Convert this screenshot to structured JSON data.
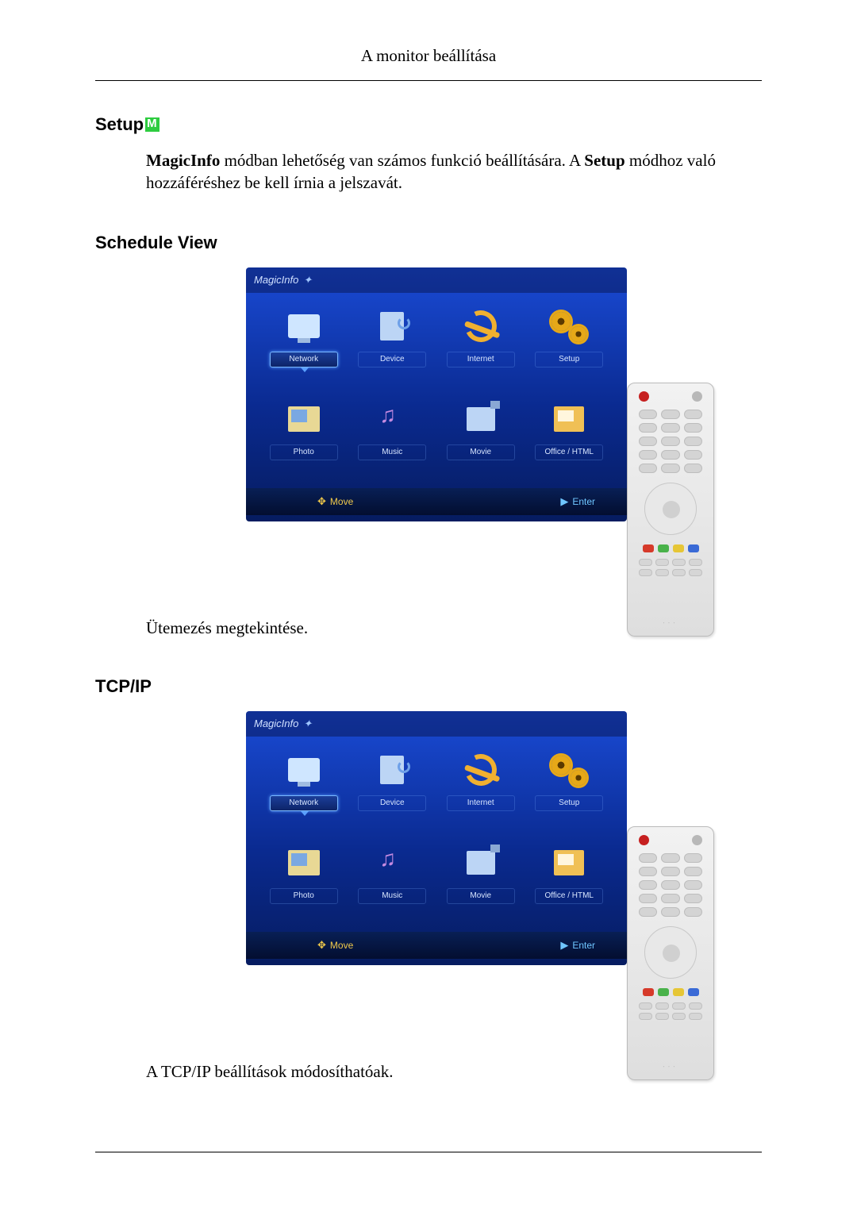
{
  "page_header": "A monitor beállítása",
  "sections": {
    "setup_heading": "Setup",
    "setup_body_bold1": "MagicInfo",
    "setup_body_mid": " módban lehetőség van számos funkció beállítására. A ",
    "setup_body_bold2": "Setup",
    "setup_body_end": " módhoz való hozzáféréshez be kell írnia a jelszavát.",
    "schedule_heading": "Schedule View",
    "schedule_caption": "Ütemezés megtekintése.",
    "tcpip_heading": "TCP/IP",
    "tcpip_caption": "A TCP/IP beállítások módosíthatóak."
  },
  "screen": {
    "brand": "MagicInfo",
    "tiles": [
      {
        "label": "Network",
        "selected": true
      },
      {
        "label": "Device",
        "selected": false
      },
      {
        "label": "Internet",
        "selected": false
      },
      {
        "label": "Setup",
        "selected": false
      },
      {
        "label": "Photo",
        "selected": false
      },
      {
        "label": "Music",
        "selected": false
      },
      {
        "label": "Movie",
        "selected": false
      },
      {
        "label": "Office / HTML",
        "selected": false
      }
    ],
    "hints": {
      "move": "Move",
      "enter": "Enter"
    }
  }
}
